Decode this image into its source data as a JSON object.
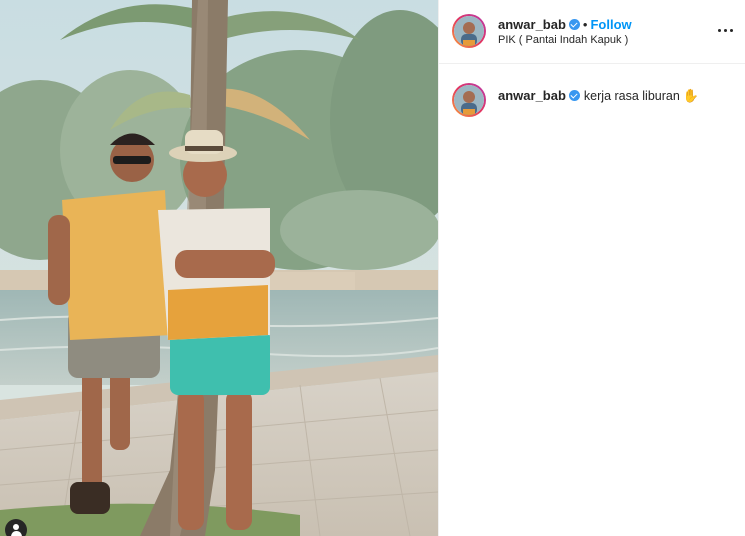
{
  "post": {
    "username": "anwar_bab",
    "follow_label": "Follow",
    "location": "PIK ( Pantai Indah Kapuk )",
    "caption": "kerja rasa liburan",
    "caption_emoji": "✋"
  },
  "icons": {
    "verified": "verified-badge-icon",
    "more": "more-options-icon",
    "user_tag": "user-tag-icon"
  },
  "colors": {
    "follow": "#0095f6",
    "verified": "#3897f0",
    "avatar_ring": "#e3355f"
  }
}
